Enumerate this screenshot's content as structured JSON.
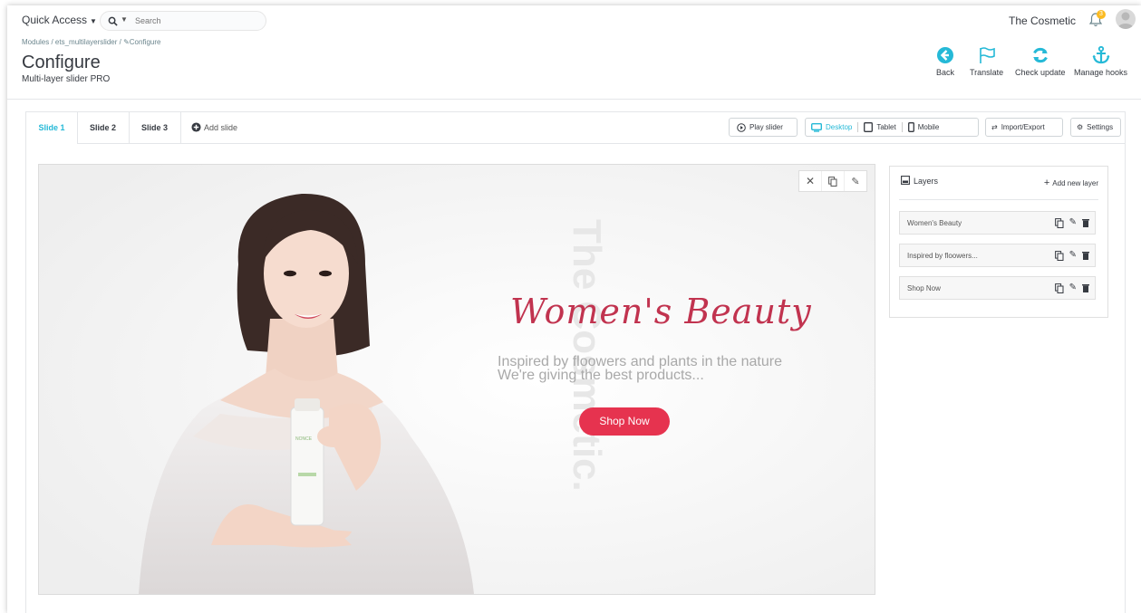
{
  "topbar": {
    "quick_access": "Quick Access",
    "search_placeholder": "Search",
    "shop_name": "The Cosmetic",
    "notification_count": "3"
  },
  "header": {
    "breadcrumb": [
      "Modules",
      "ets_multilayerslider",
      "Configure"
    ],
    "title": "Configure",
    "subtitle": "Multi-layer slider PRO",
    "toolbar": [
      {
        "label": "Back",
        "icon": "back-circle-icon"
      },
      {
        "label": "Translate",
        "icon": "flag-icon"
      },
      {
        "label": "Check update",
        "icon": "refresh-icon"
      },
      {
        "label": "Manage hooks",
        "icon": "anchor-icon"
      }
    ]
  },
  "tabs": [
    {
      "label": "Slide 1",
      "active": true
    },
    {
      "label": "Slide 2"
    },
    {
      "label": "Slide 3"
    }
  ],
  "add_slide": "Add slide",
  "actions": {
    "play": "Play slider",
    "desktop": "Desktop",
    "tablet": "Tablet",
    "mobile": "Mobile",
    "import_export": "Import/Export",
    "settings": "Settings"
  },
  "slide": {
    "watermark": "The Cosmetic.",
    "title": "Women's Beauty",
    "line1": "Inspired by floowers and plants in the nature",
    "line2": "We're giving the best products...",
    "button": "Shop Now",
    "bottle_text": "NONCE"
  },
  "layers": {
    "title": "Layers",
    "add": "Add new layer",
    "items": [
      "Women's Beauty",
      "Inspired by floowers...",
      "Shop Now"
    ]
  },
  "colors": {
    "accent": "#25b9d7",
    "title": "#c1334f",
    "button": "#e6334f",
    "tool_blue": "#25b9d7"
  }
}
